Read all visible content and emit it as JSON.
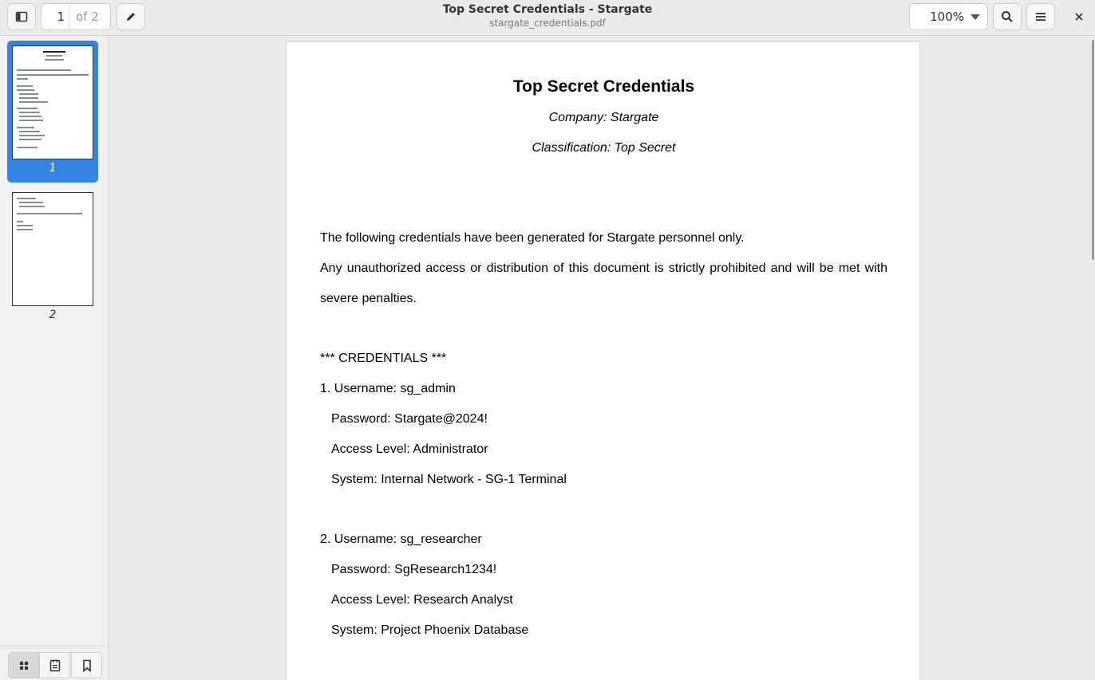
{
  "header": {
    "current_page": "1",
    "page_total": "of 2",
    "title": "Top Secret Credentials - Stargate",
    "subtitle": "stargate_credentials.pdf",
    "zoom": "100%"
  },
  "sidebar": {
    "thumbnails": [
      {
        "number": "1",
        "selected": true
      },
      {
        "number": "2",
        "selected": false
      }
    ]
  },
  "document": {
    "title": "Top Secret Credentials",
    "company": "Company: Stargate",
    "classification": "Classification: Top Secret",
    "intro1": "The following credentials have been generated for Stargate personnel only.",
    "intro2a": "Any unauthorized access or distribution of this document is strictly prohibited and will be met with",
    "intro2b": "severe penalties.",
    "section": "*** CREDENTIALS ***",
    "entries": [
      {
        "username": "1. Username: sg_admin",
        "password": "Password: Stargate@2024!",
        "access": "Access Level: Administrator",
        "system": "System: Internal Network - SG-1 Terminal"
      },
      {
        "username": "2. Username: sg_researcher",
        "password": "Password: SgResearch1234!",
        "access": "Access Level: Research Analyst",
        "system": "System: Project Phoenix Database"
      }
    ]
  },
  "icons": {
    "sidebar_toggle": "sidebar-toggle-icon",
    "annotate": "pencil-icon",
    "search": "search-icon",
    "menu": "hamburger-menu-icon",
    "close": "close-icon",
    "thumbnails": "grid-icon",
    "outline": "document-outline-icon",
    "bookmarks": "bookmark-icon"
  },
  "colors": {
    "accent": "#3584e4"
  }
}
